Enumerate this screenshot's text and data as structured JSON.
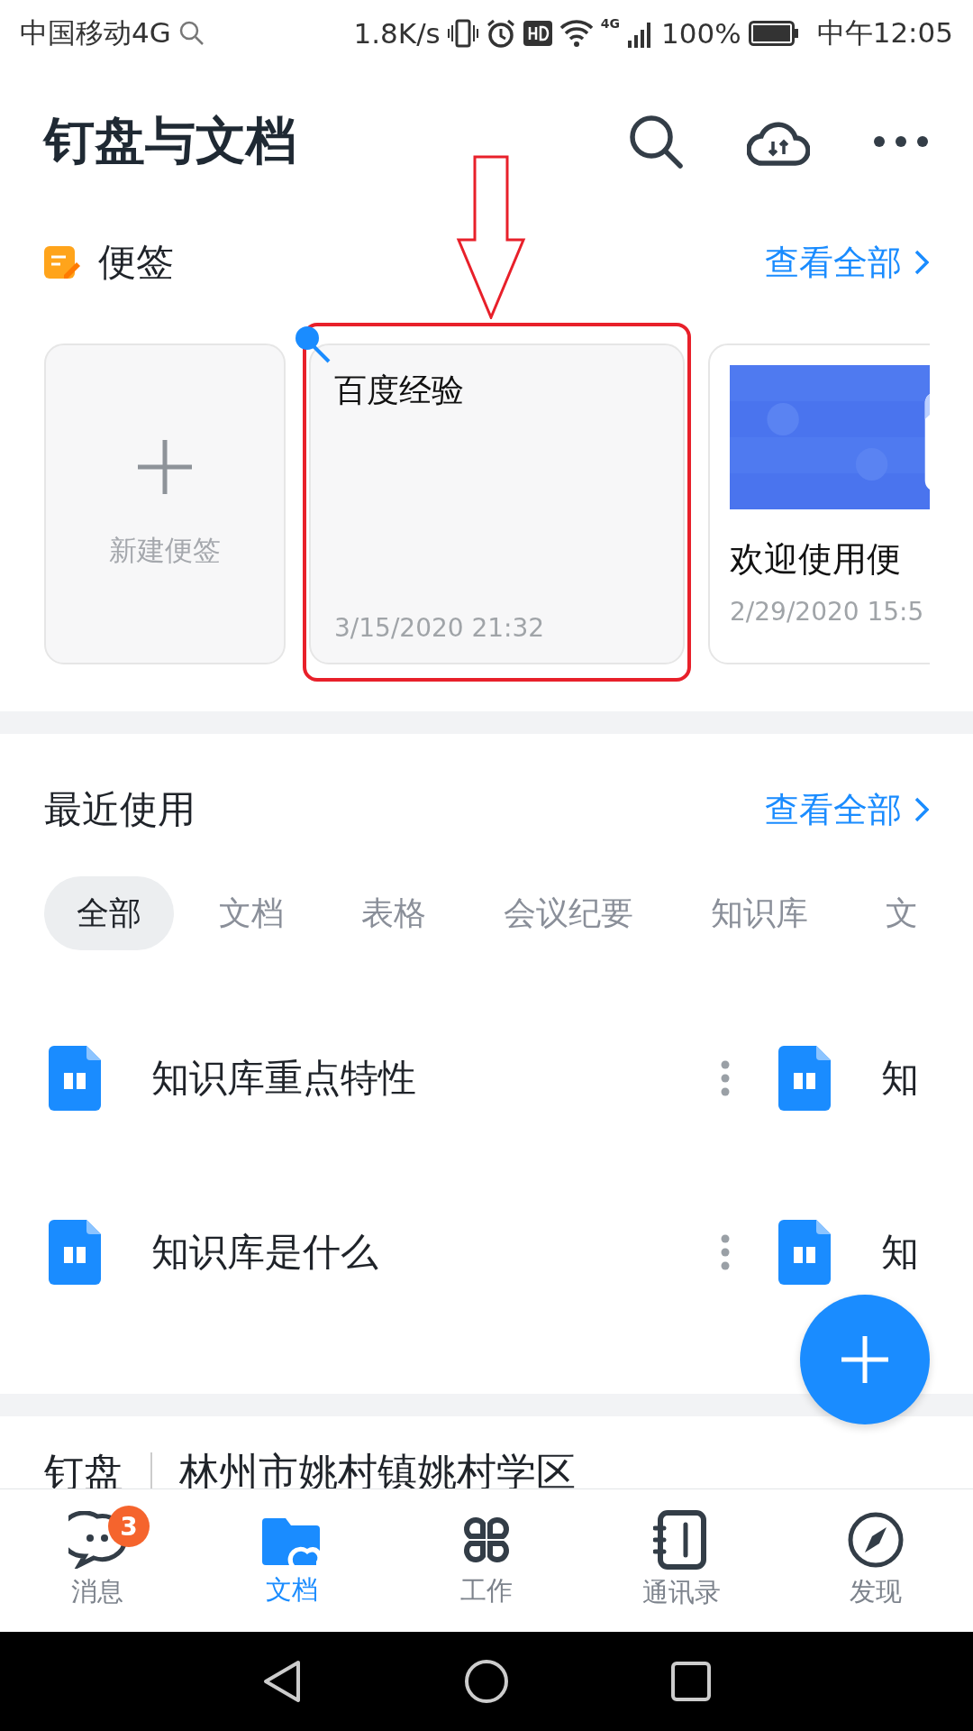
{
  "status_bar": {
    "carrier": "中国移动4G",
    "speed": "1.8K/s",
    "network": "4G",
    "battery": "100%",
    "time": "中午12:05"
  },
  "header": {
    "title": "钉盘与文档"
  },
  "notes": {
    "title": "便签",
    "view_all": "查看全部",
    "new_note": "新建便签",
    "items": [
      {
        "kind": "text",
        "title": "百度经验",
        "date": "3/15/2020 21:32",
        "pinned": true,
        "highlighted": true
      },
      {
        "kind": "picture",
        "title": "欢迎使用便",
        "date": "2/29/2020 15:5",
        "pinned": false,
        "highlighted": false
      }
    ]
  },
  "recent": {
    "title": "最近使用",
    "view_all": "查看全部",
    "tabs": [
      {
        "label": "全部",
        "selected": true
      },
      {
        "label": "文档",
        "selected": false
      },
      {
        "label": "表格",
        "selected": false
      },
      {
        "label": "会议纪要",
        "selected": false
      },
      {
        "label": "知识库",
        "selected": false
      },
      {
        "label": "文",
        "selected": false
      }
    ],
    "rows": [
      {
        "left": "知识库重点特性",
        "right": "知"
      },
      {
        "left": "知识库是什么",
        "right": "知"
      }
    ]
  },
  "drive_bar": {
    "label": "钉盘",
    "location": "林州市姚村镇姚村学区"
  },
  "nav": [
    {
      "kind": "chat",
      "label": "消息",
      "selected": false,
      "badge": "3"
    },
    {
      "kind": "folder",
      "label": "文档",
      "selected": true
    },
    {
      "kind": "apps",
      "label": "工作",
      "selected": false
    },
    {
      "kind": "contacts",
      "label": "通讯录",
      "selected": false
    },
    {
      "kind": "compass",
      "label": "发现",
      "selected": false
    }
  ]
}
